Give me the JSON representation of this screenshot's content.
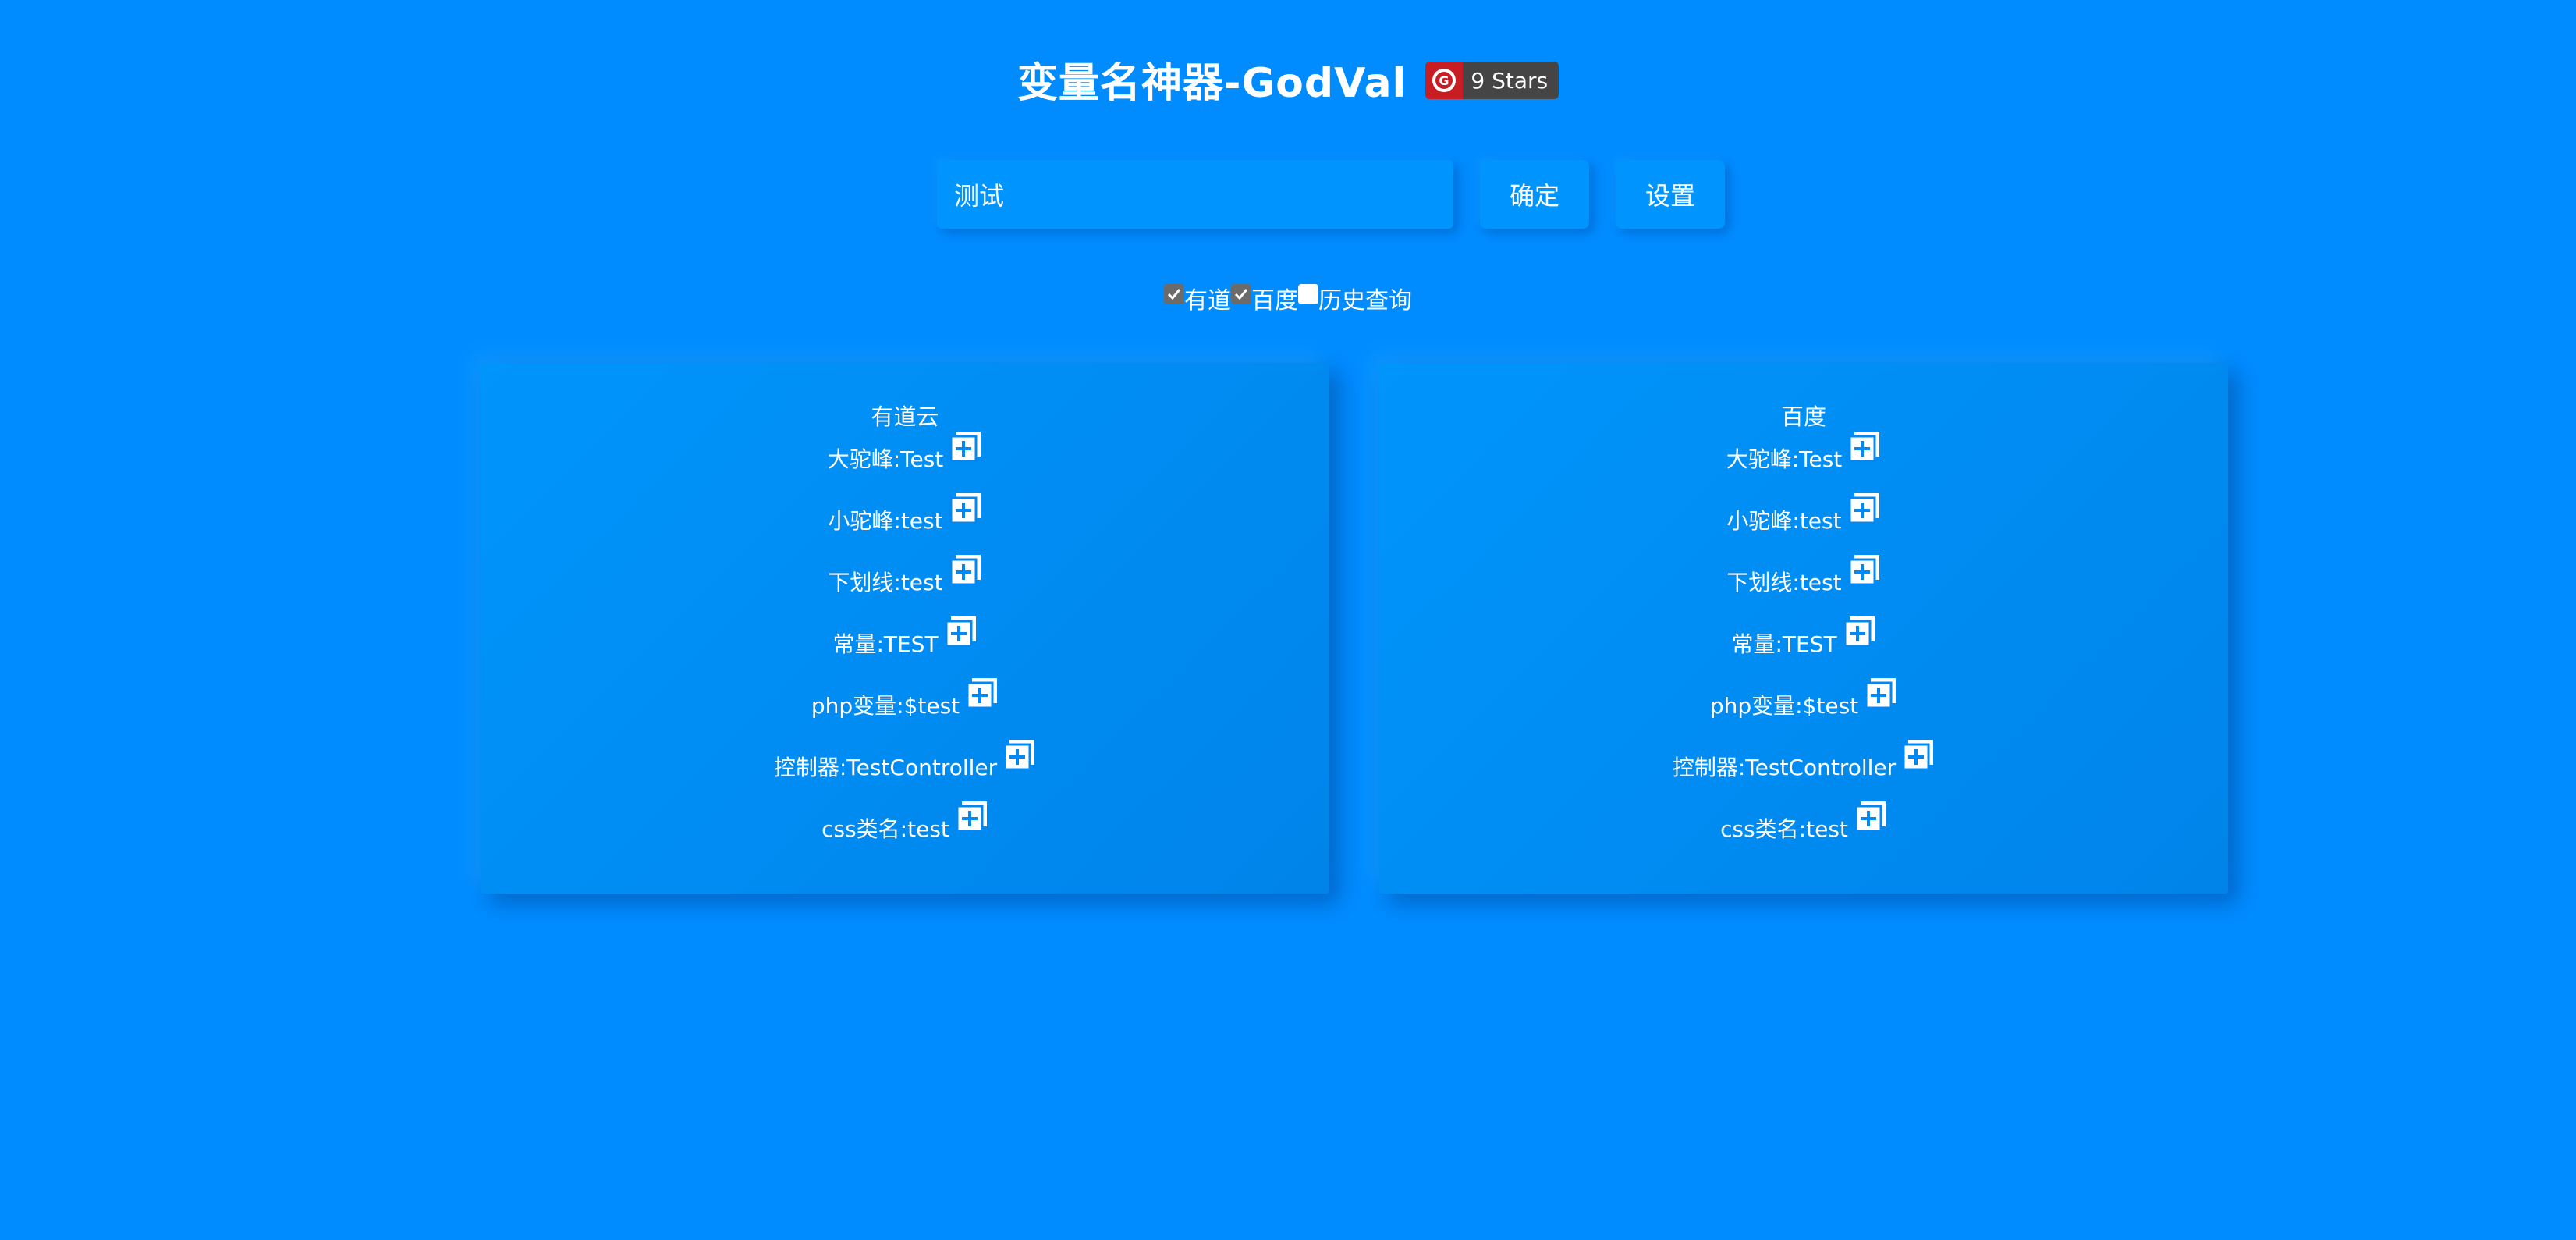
{
  "header": {
    "title": "变量名神器-GodVal",
    "badge_text": "9 Stars",
    "badge_logo_letter": "G"
  },
  "search": {
    "value": "测试",
    "confirm_label": "确定",
    "settings_label": "设置"
  },
  "options": [
    {
      "label": "有道",
      "checked": true
    },
    {
      "label": "百度",
      "checked": true
    },
    {
      "label": "历史查询",
      "checked": false
    }
  ],
  "panels": [
    {
      "title": "有道云",
      "rows": [
        {
          "text": "大驼峰:Test"
        },
        {
          "text": "小驼峰:test"
        },
        {
          "text": "下划线:test"
        },
        {
          "text": "常量:TEST"
        },
        {
          "text": "php变量:$test"
        },
        {
          "text": "控制器:TestController"
        },
        {
          "text": "css类名:test"
        }
      ]
    },
    {
      "title": "百度",
      "rows": [
        {
          "text": "大驼峰:Test"
        },
        {
          "text": "小驼峰:test"
        },
        {
          "text": "下划线:test"
        },
        {
          "text": "常量:TEST"
        },
        {
          "text": "php变量:$test"
        },
        {
          "text": "控制器:TestController"
        },
        {
          "text": "css类名:test"
        }
      ]
    }
  ],
  "icons": {
    "copy": "copy-icon",
    "check": "checkmark-icon",
    "gitee": "gitee-logo-icon"
  },
  "colors": {
    "background": "#008cff",
    "badge_dark": "#454545",
    "badge_red": "#c71d23"
  }
}
